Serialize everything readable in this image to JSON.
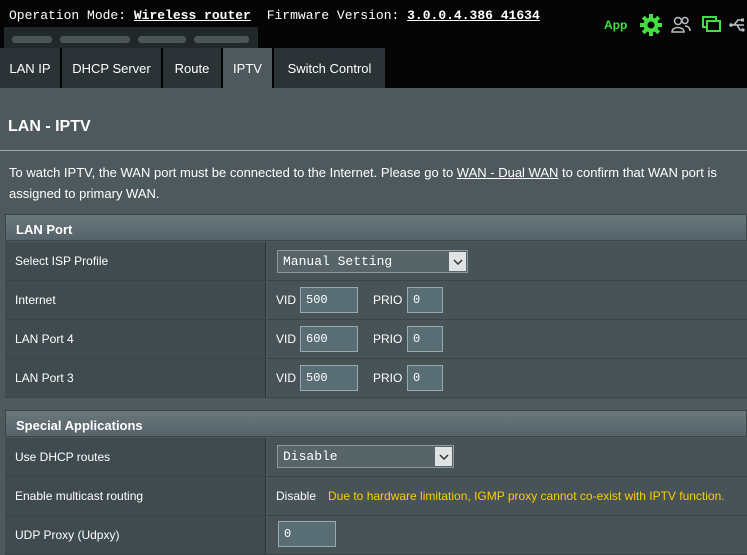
{
  "header": {
    "operation_mode_label": "Operation Mode:",
    "operation_mode_value": "Wireless router",
    "firmware_label": "Firmware Version:",
    "firmware_value": "3.0.0.4.386_41634",
    "app_label": "App",
    "icons": [
      "gear-icon",
      "users-icon",
      "monitor-icon",
      "usb-icon"
    ],
    "accent_color": "#43e043"
  },
  "tabs": [
    {
      "label": "LAN IP",
      "active": false
    },
    {
      "label": "DHCP Server",
      "active": false
    },
    {
      "label": "Route",
      "active": false
    },
    {
      "label": "IPTV",
      "active": true
    },
    {
      "label": "Switch Control",
      "active": false
    }
  ],
  "page": {
    "title": "LAN - IPTV",
    "description_before": "To watch IPTV, the WAN port must be connected to the Internet. Please go to ",
    "description_link": "WAN - Dual WAN",
    "description_after": " to confirm that WAN port is assigned to primary WAN."
  },
  "lan_port": {
    "heading": "LAN Port",
    "isp_profile_label": "Select ISP Profile",
    "isp_profile_value": "Manual Setting",
    "vid_label": "VID",
    "prio_label": "PRIO",
    "rows": [
      {
        "label": "Internet",
        "vid": "500",
        "prio": "0"
      },
      {
        "label": "LAN Port 4",
        "vid": "600",
        "prio": "0"
      },
      {
        "label": "LAN Port 3",
        "vid": "500",
        "prio": "0"
      }
    ]
  },
  "special": {
    "heading": "Special Applications",
    "dhcp_routes_label": "Use DHCP routes",
    "dhcp_routes_value": "Disable",
    "multicast_label": "Enable multicast routing",
    "multicast_value": "Disable",
    "multicast_warning": "Due to hardware limitation, IGMP proxy cannot co-exist with IPTV function.",
    "udpxy_label": "UDP Proxy (Udpxy)",
    "udpxy_value": "0",
    "warning_color": "#ffcc00"
  }
}
